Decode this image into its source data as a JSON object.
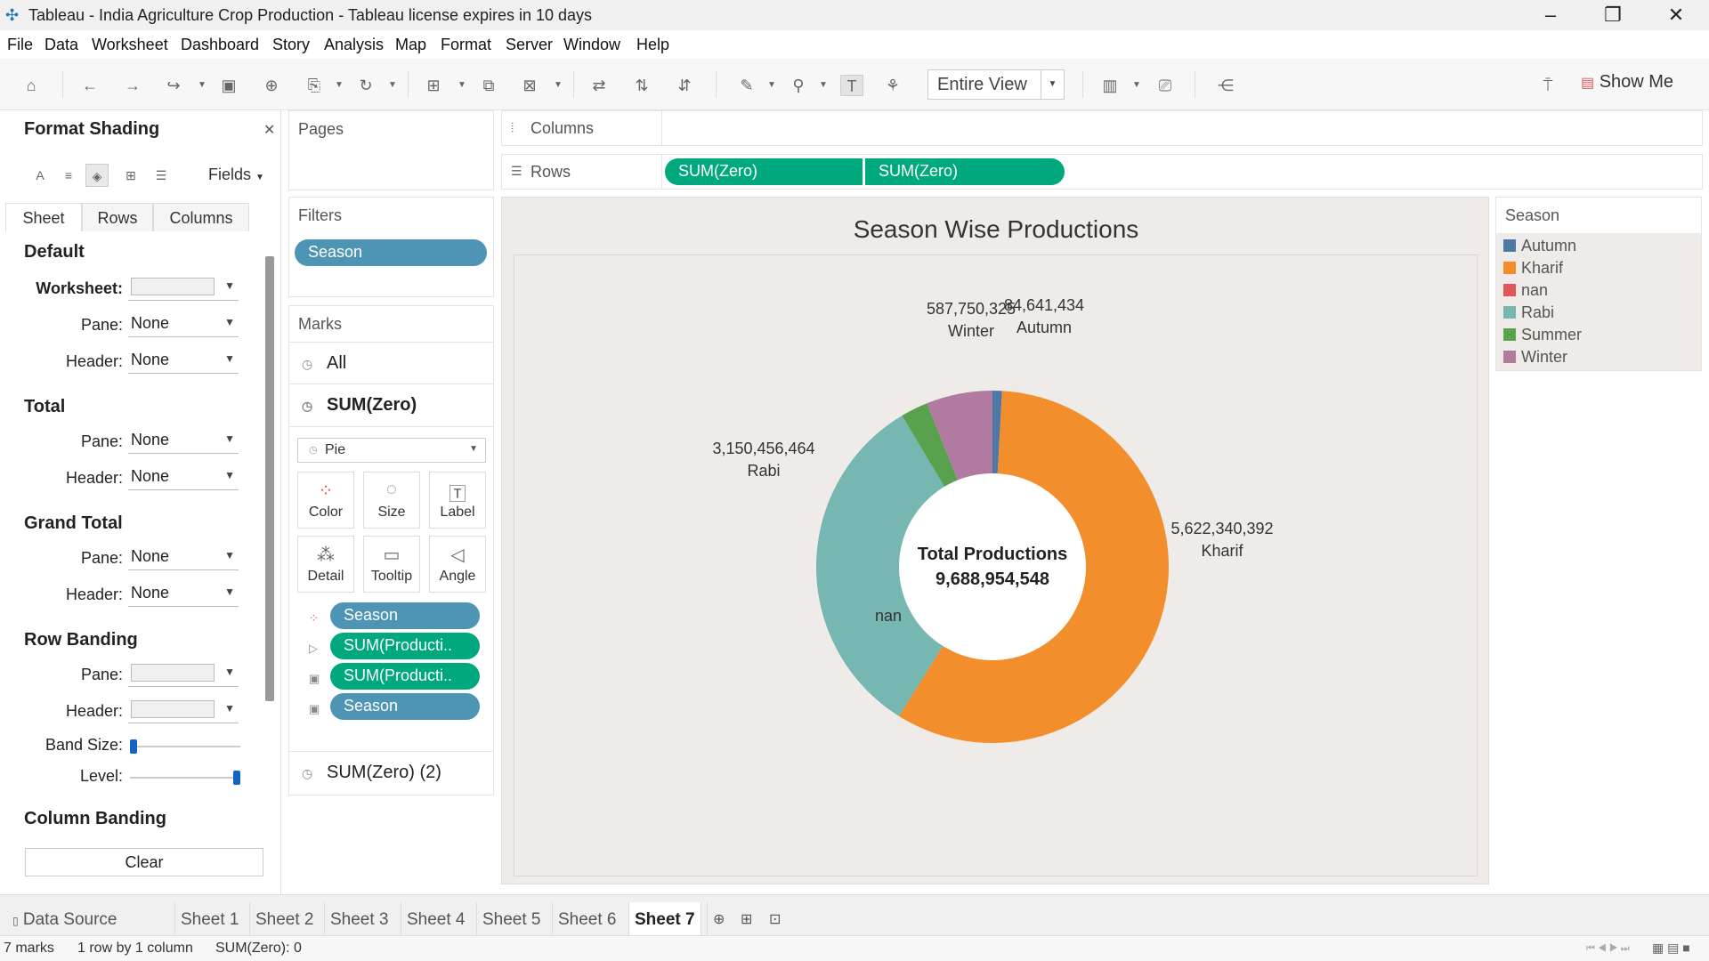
{
  "window": {
    "title": "Tableau - India Agriculture Crop Production - Tableau license expires in 10 days",
    "app_icon": "tableau-cross-icon"
  },
  "menu": [
    "File",
    "Data",
    "Worksheet",
    "Dashboard",
    "Story",
    "Analysis",
    "Map",
    "Format",
    "Server",
    "Window",
    "Help"
  ],
  "toolbar": {
    "view_mode": "Entire View",
    "show_me": "Show Me"
  },
  "format_pane": {
    "title": "Format Shading",
    "fields_label": "Fields",
    "tabs": [
      "Sheet",
      "Rows",
      "Columns"
    ],
    "active_tab": "Sheet",
    "sections": {
      "default": "Default",
      "total": "Total",
      "grand_total": "Grand Total",
      "row_banding": "Row Banding",
      "column_banding": "Column Banding"
    },
    "labels": {
      "worksheet": "Worksheet:",
      "pane": "Pane:",
      "header": "Header:",
      "band_size": "Band Size:",
      "level": "Level:"
    },
    "none": "None",
    "band_size_value": 0,
    "level_value": 1,
    "clear": "Clear"
  },
  "pages": {
    "title": "Pages"
  },
  "filters": {
    "title": "Filters",
    "items": [
      "Season"
    ]
  },
  "marks": {
    "title": "Marks",
    "all": "All",
    "primary": "SUM(Zero)",
    "mark_type": "Pie",
    "buttons": [
      "Color",
      "Size",
      "Label",
      "Detail",
      "Tooltip",
      "Angle"
    ],
    "fields": [
      "Season",
      "SUM(Producti..",
      "SUM(Producti..",
      "Season"
    ],
    "secondary": "SUM(Zero) (2)"
  },
  "shelves": {
    "columns_label": "Columns",
    "rows_label": "Rows",
    "rows_pills": [
      "SUM(Zero)",
      "SUM(Zero)"
    ]
  },
  "chart_data": {
    "type": "pie",
    "title": "Season Wise Productions",
    "center_label": "Total Productions",
    "center_value": "9,688,954,548",
    "slices": [
      {
        "name": "Autumn",
        "value": 84641434,
        "label": "84,641,434",
        "color": "#4e79a7"
      },
      {
        "name": "Kharif",
        "value": 5622340392,
        "label": "5,622,340,392",
        "color": "#f28e2b"
      },
      {
        "name": "nan",
        "value": 6,
        "label": "",
        "color": "#e15759"
      },
      {
        "name": "Rabi",
        "value": 3150456464,
        "label": "3,150,456,464",
        "color": "#76b7b2"
      },
      {
        "name": "Summer",
        "value": 243759937,
        "label": "",
        "color": "#59a14f"
      },
      {
        "name": "Winter",
        "value": 587750325,
        "label": "587,750,325",
        "color": "#b07aa1"
      }
    ]
  },
  "legend": {
    "title": "Season",
    "items": [
      {
        "name": "Autumn",
        "color": "#4e79a7"
      },
      {
        "name": "Kharif",
        "color": "#f28e2b"
      },
      {
        "name": "nan",
        "color": "#e15759"
      },
      {
        "name": "Rabi",
        "color": "#76b7b2"
      },
      {
        "name": "Summer",
        "color": "#59a14f"
      },
      {
        "name": "Winter",
        "color": "#b07aa1"
      }
    ]
  },
  "sheet_tabs": {
    "data_source": "Data Source",
    "sheets": [
      "Sheet 1",
      "Sheet 2",
      "Sheet 3",
      "Sheet 4",
      "Sheet 5",
      "Sheet 6",
      "Sheet 7"
    ],
    "active": "Sheet 7"
  },
  "status": {
    "marks": "7 marks",
    "dims": "1 row by 1 column",
    "sum": "SUM(Zero): 0"
  }
}
